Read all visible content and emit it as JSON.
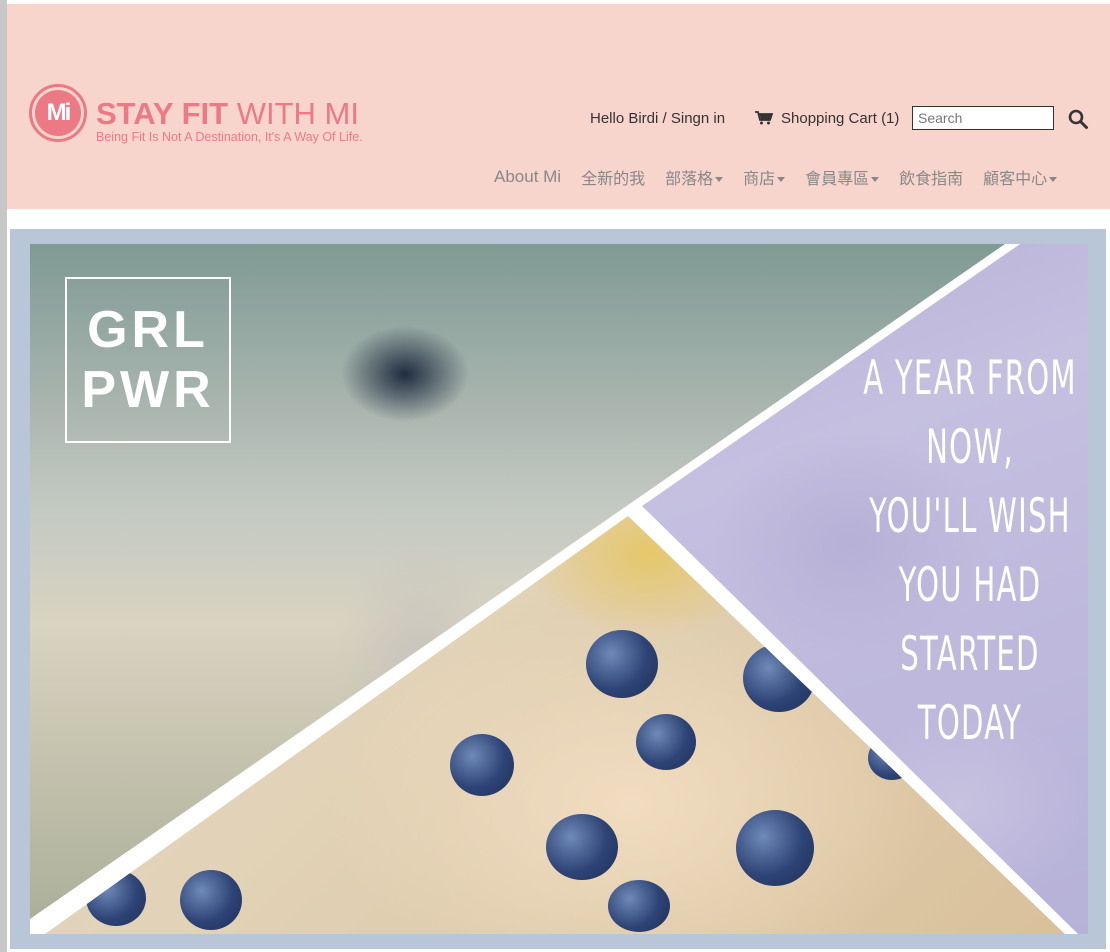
{
  "header": {
    "logo": {
      "mark": "Mi",
      "name_bold": "STAY FIT",
      "name_thin": " WITH MI",
      "tagline": "Being Fit Is Not A Destination, It's A Way Of Life."
    },
    "greeting": "Hello Birdi / Singn in",
    "cart_label": "Shopping Cart (1)",
    "search_placeholder": "Search",
    "nav": [
      {
        "label": "About Mi",
        "dropdown": false
      },
      {
        "label": "全新的我",
        "dropdown": false
      },
      {
        "label": "部落格",
        "dropdown": true
      },
      {
        "label": "商店",
        "dropdown": true
      },
      {
        "label": "會員專區",
        "dropdown": true
      },
      {
        "label": "飲食指南",
        "dropdown": false
      },
      {
        "label": "顧客中心",
        "dropdown": true
      }
    ]
  },
  "banner": {
    "badge_lines": [
      "GRL",
      "PWR"
    ],
    "quote_lines": [
      "A YEAR FROM",
      "NOW,",
      "YOU'LL WISH",
      "YOU HAD",
      "STARTED",
      "TODAY"
    ]
  },
  "colors": {
    "header_bg": "#f8d5cc",
    "brand": "#ec7a85",
    "banner_frame": "#b9c6d8",
    "nav_text": "#888888"
  }
}
